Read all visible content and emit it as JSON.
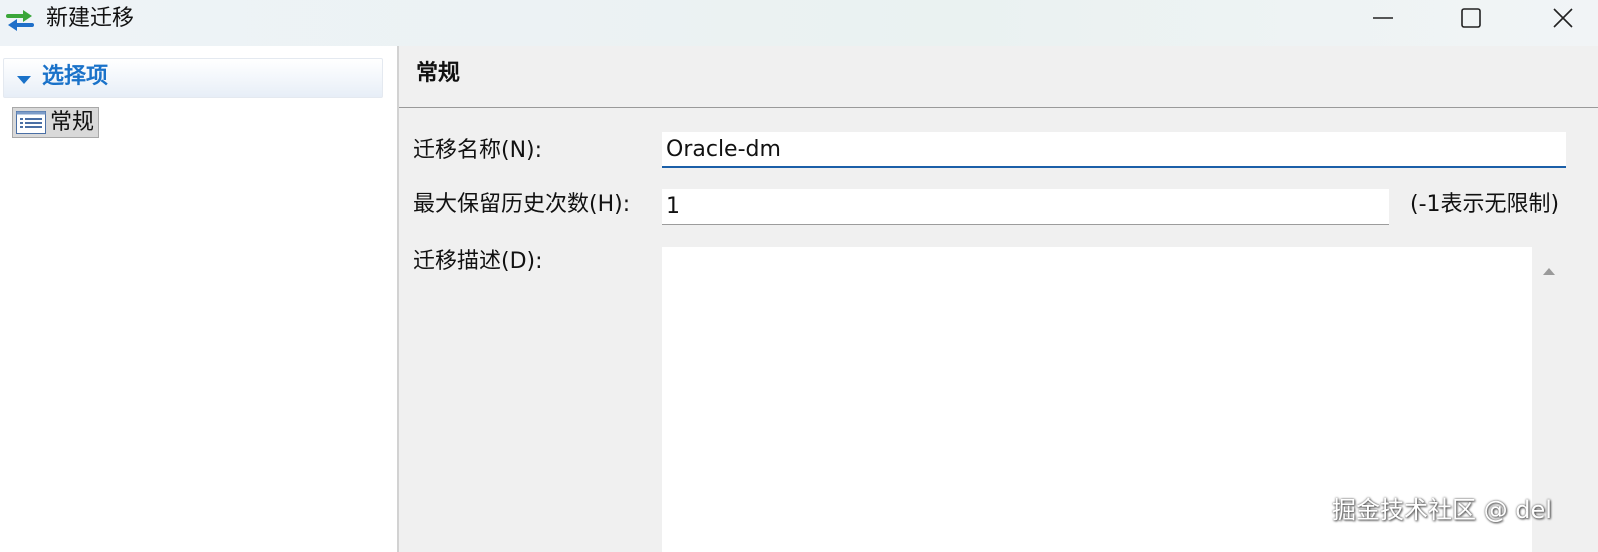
{
  "window": {
    "title": "新建迁移",
    "icon": "swap-arrows-icon",
    "controls": {
      "minimize": "minimize-icon",
      "maximize": "maximize-icon",
      "close": "close-icon"
    }
  },
  "sidebar": {
    "section_title": "选择项",
    "items": [
      {
        "label": "常规",
        "icon": "list-icon",
        "selected": true
      }
    ]
  },
  "main": {
    "page_title": "常规",
    "fields": {
      "name": {
        "label": "迁移名称(N):",
        "value": "Oracle-dm"
      },
      "history": {
        "label": "最大保留历史次数(H):",
        "value": "1",
        "hint": "(-1表示无限制)"
      },
      "description": {
        "label": "迁移描述(D):",
        "value": ""
      }
    }
  },
  "watermark": "掘金技术社区 @ del",
  "colors": {
    "accent": "#1a72c9",
    "focus_border": "#1b5fa8",
    "arrow_green": "#3aa63a",
    "arrow_blue": "#1f6fc9"
  }
}
